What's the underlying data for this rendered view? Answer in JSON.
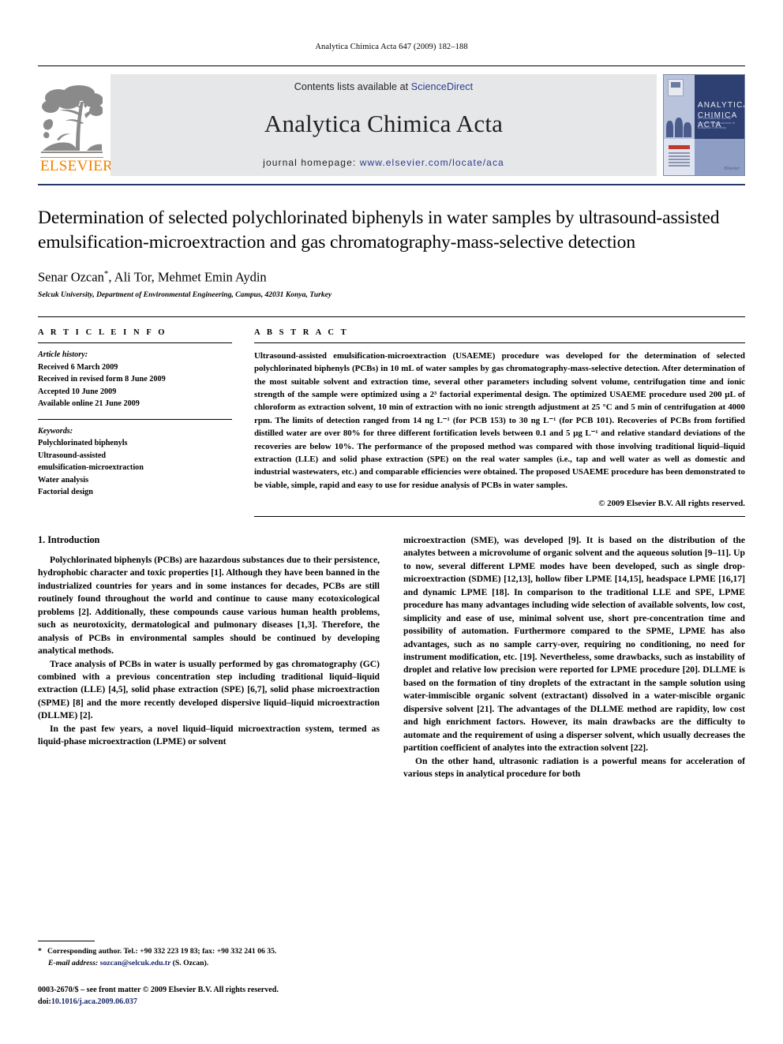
{
  "running_head": "Analytica Chimica Acta 647 (2009) 182–188",
  "masthead": {
    "publisher_name": "ELSEVIER",
    "contents_prefix": "Contents lists available at ",
    "contents_link": "ScienceDirect",
    "journal_name": "Analytica Chimica Acta",
    "homepage_prefix": "journal homepage: ",
    "homepage_url": "www.elsevier.com/locate/aca",
    "cover_title_line1": "ANALYTICA",
    "cover_title_line2": "CHIMICA ACTA",
    "cover_sub": "An International Journal Devoted to All Branches of Analytical Chemistry",
    "cover_publisher": "Elsevier",
    "rule_color": "#283a6b",
    "link_color": "#2b3a8f"
  },
  "article": {
    "title": "Determination of selected polychlorinated biphenyls in water samples by ultrasound-assisted emulsification-microextraction and gas chromatography-mass-selective detection",
    "authors": "Senar Ozcan",
    "authors_rest": ", Ali Tor, Mehmet Emin Aydin",
    "corresponding_marker": "*",
    "affiliation": "Selcuk University, Department of Environmental Engineering, Campus, 42031 Konya, Turkey"
  },
  "article_info": {
    "heading": "A R T I C L E   I N F O",
    "history_label": "Article history:",
    "history": [
      "Received 6 March 2009",
      "Received in revised form 8 June 2009",
      "Accepted 10 June 2009",
      "Available online 21 June 2009"
    ],
    "keywords_label": "Keywords:",
    "keywords": [
      "Polychlorinated biphenyls",
      "Ultrasound-assisted",
      "emulsification-microextraction",
      "Water analysis",
      "Factorial design"
    ]
  },
  "abstract": {
    "heading": "A B S T R A C T",
    "text": "Ultrasound-assisted emulsification-microextraction (USAEME) procedure was developed for the determination of selected polychlorinated biphenyls (PCBs) in 10 mL of water samples by gas chromatography-mass-selective detection. After determination of the most suitable solvent and extraction time, several other parameters including solvent volume, centrifugation time and ionic strength of the sample were optimized using a 2³ factorial experimental design. The optimized USAEME procedure used 200 µL of chloroform as extraction solvent, 10 min of extraction with no ionic strength adjustment at 25 °C and 5 min of centrifugation at 4000 rpm. The limits of detection ranged from 14 ng L⁻¹ (for PCB 153) to 30 ng L⁻¹ (for PCB 101). Recoveries of PCBs from fortified distilled water are over 80% for three different fortification levels between 0.1 and 5 µg L⁻¹ and relative standard deviations of the recoveries are below 10%. The performance of the proposed method was compared with those involving traditional liquid–liquid extraction (LLE) and solid phase extraction (SPE) on the real water samples (i.e., tap and well water as well as domestic and industrial wastewaters, etc.) and comparable efficiencies were obtained. The proposed USAEME procedure has been demonstrated to be viable, simple, rapid and easy to use for residue analysis of PCBs in water samples.",
    "copyright": "© 2009 Elsevier B.V. All rights reserved."
  },
  "introduction": {
    "heading": "1.  Introduction",
    "left_paragraphs": [
      "Polychlorinated biphenyls (PCBs) are hazardous substances due to their persistence, hydrophobic character and toxic properties [1]. Although they have been banned in the industrialized countries for years and in some instances for decades, PCBs are still routinely found throughout the world and continue to cause many ecotoxicological problems [2]. Additionally, these compounds cause various human health problems, such as neurotoxicity, dermatological and pulmonary diseases [1,3]. Therefore, the analysis of PCBs in environmental samples should be continued by developing analytical methods.",
      "Trace analysis of PCBs in water is usually performed by gas chromatography (GC) combined with a previous concentration step including traditional liquid–liquid extraction (LLE) [4,5], solid phase extraction (SPE) [6,7], solid phase microextraction (SPME) [8] and the more recently developed dispersive liquid–liquid microextraction (DLLME) [2].",
      "In the past few years, a novel liquid–liquid microextraction system, termed as liquid-phase microextraction (LPME) or solvent"
    ],
    "right_paragraphs": [
      "microextraction (SME), was developed [9]. It is based on the distribution of the analytes between a microvolume of organic solvent and the aqueous solution [9–11]. Up to now, several different LPME modes have been developed, such as single drop-microextraction (SDME) [12,13], hollow fiber LPME [14,15], headspace LPME [16,17] and dynamic LPME [18]. In comparison to the traditional LLE and SPE, LPME procedure has many advantages including wide selection of available solvents, low cost, simplicity and ease of use, minimal solvent use, short pre-concentration time and possibility of automation. Furthermore compared to the SPME, LPME has also advantages, such as no sample carry-over, requiring no conditioning, no need for instrument modification, etc. [19]. Nevertheless, some drawbacks, such as instability of droplet and relative low precision were reported for LPME procedure [20]. DLLME is based on the formation of tiny droplets of the extractant in the sample solution using water-immiscible organic solvent (extractant) dissolved in a water-miscible organic dispersive solvent [21]. The advantages of the DLLME method are rapidity, low cost and high enrichment factors. However, its main drawbacks are the difficulty to automate and the requirement of using a disperser solvent, which usually decreases the partition coefficient of analytes into the extraction solvent [22].",
      "On the other hand, ultrasonic radiation is a powerful means for acceleration of various steps in analytical procedure for both"
    ]
  },
  "footnote": {
    "marker": "*",
    "corresponding": "Corresponding author. Tel.: +90 332 223 19 83; fax: +90 332 241 06 35.",
    "email_label": "E-mail address:",
    "email": "sozcan@selcuk.edu.tr",
    "email_owner": "(S. Ozcan)."
  },
  "bottom": {
    "issn_line": "0003-2670/$ – see front matter © 2009 Elsevier B.V. All rights reserved.",
    "doi_label": "doi:",
    "doi": "10.1016/j.aca.2009.06.037"
  }
}
